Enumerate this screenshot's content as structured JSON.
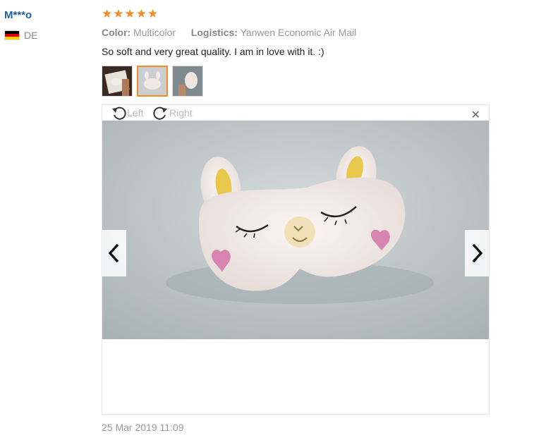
{
  "review": {
    "user_name": "M***o",
    "country": "DE",
    "rating": 5,
    "rating_max": 5,
    "color_label": "Color:",
    "color_value": "Multicolor",
    "logistics_label": "Logistics:",
    "logistics_value": "Yanwen Economic Air Mail",
    "feedback": "So soft and very great quality. I am in love with it. :)",
    "date": "25 Mar 2019 11:09",
    "active_thumbnail": 2
  },
  "viewer": {
    "rotate_left_label": "Left",
    "rotate_right_label": "Right",
    "close_icon": "close-icon",
    "prev_icon": "chevron-left-icon",
    "next_icon": "chevron-right-icon"
  },
  "colors": {
    "username": "#1f5fa8",
    "star": "#f68a23",
    "active_border": "#f68a23"
  }
}
